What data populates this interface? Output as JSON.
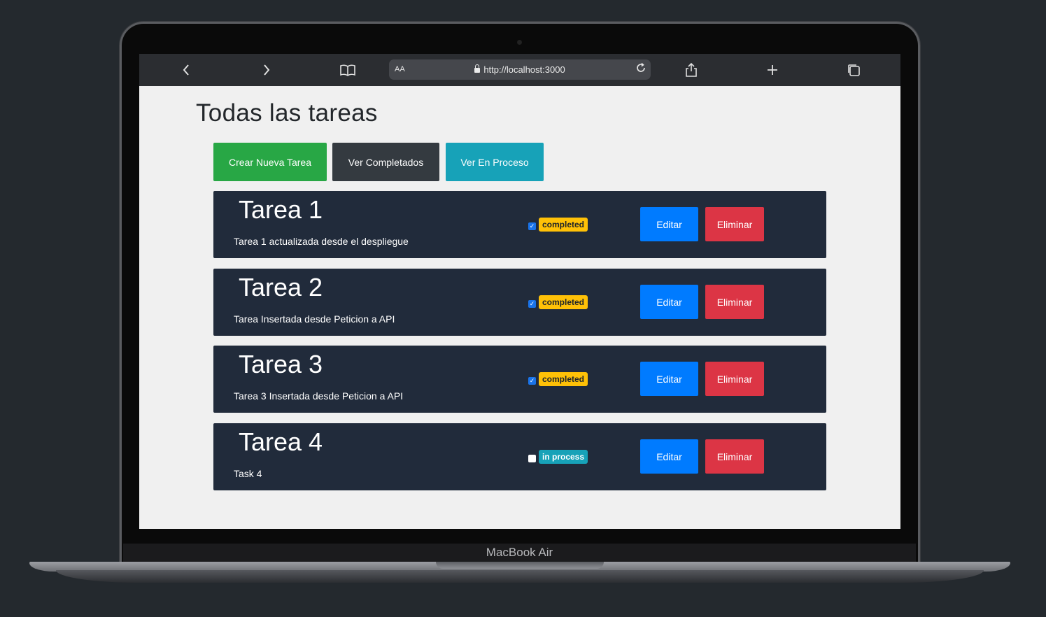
{
  "device": {
    "brand": "MacBook Air"
  },
  "browser": {
    "back_icon": "chevron-left-icon",
    "forward_icon": "chevron-right-icon",
    "bookmarks_icon": "book-icon",
    "aa_label": "AA",
    "url": "http://localhost:3000",
    "reload_icon": "reload-icon",
    "share_icon": "share-icon",
    "new_tab_icon": "plus-icon",
    "tabs_icon": "tabs-icon"
  },
  "page": {
    "title": "Todas las tareas",
    "actions": {
      "create": "Crear Nueva Tarea",
      "completed": "Ver Completados",
      "in_process": "Ver En Proceso"
    },
    "tasks": [
      {
        "title": "Tarea 1",
        "description": "Tarea 1 actualizada desde el despliegue",
        "checked": true,
        "status": "completed",
        "edit": "Editar",
        "delete": "Eliminar"
      },
      {
        "title": "Tarea 2",
        "description": "Tarea Insertada desde Peticion a API",
        "checked": true,
        "status": "completed",
        "edit": "Editar",
        "delete": "Eliminar"
      },
      {
        "title": "Tarea 3",
        "description": "Tarea 3 Insertada desde Peticion a API",
        "checked": true,
        "status": "completed",
        "edit": "Editar",
        "delete": "Eliminar"
      },
      {
        "title": "Tarea 4",
        "description": "Task 4",
        "checked": false,
        "status": "in process",
        "edit": "Editar",
        "delete": "Eliminar"
      }
    ]
  },
  "colors": {
    "background": "#24292e",
    "page_bg": "#f0f0f0",
    "card_bg": "#212b3b",
    "create_button": "#28a745",
    "completed_button": "#343a40",
    "in_process_button": "#17a2b8",
    "edit_button": "#007bff",
    "delete_button": "#dc3545",
    "badge_completed": "#ffc107",
    "badge_in_process": "#17a2b8"
  }
}
